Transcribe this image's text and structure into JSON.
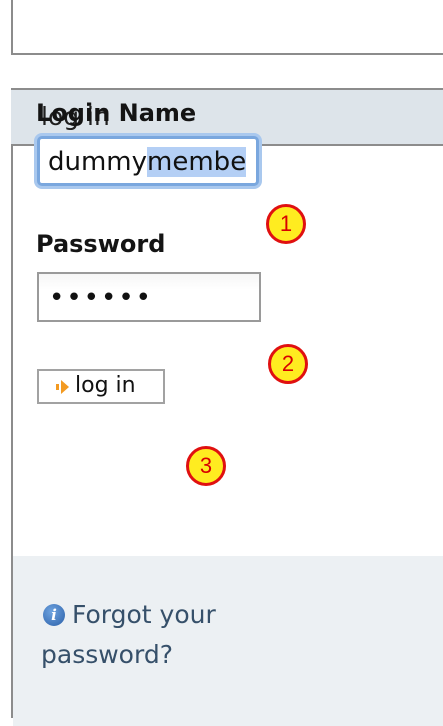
{
  "portlet": {
    "title": "log in"
  },
  "login": {
    "label": "Login Name",
    "value_plain": "dummy",
    "value_selected": "memb",
    "value_cut": "e"
  },
  "password": {
    "label": "Password",
    "value": "••••••"
  },
  "button": {
    "label": "log in"
  },
  "callouts": [
    "1",
    "2",
    "3"
  ],
  "forgot": {
    "line1": "Forgot your",
    "line2": "password?"
  },
  "icons": {
    "button_arrow": "orange-arrow-icon",
    "info": "info-icon"
  },
  "colors": {
    "header_bg": "#dde4ea",
    "footer_bg": "#ecf0f3",
    "focus_ring": "#7aa7de",
    "callout_fill": "#ffec20",
    "callout_border": "#e01010",
    "link": "#36506a"
  }
}
